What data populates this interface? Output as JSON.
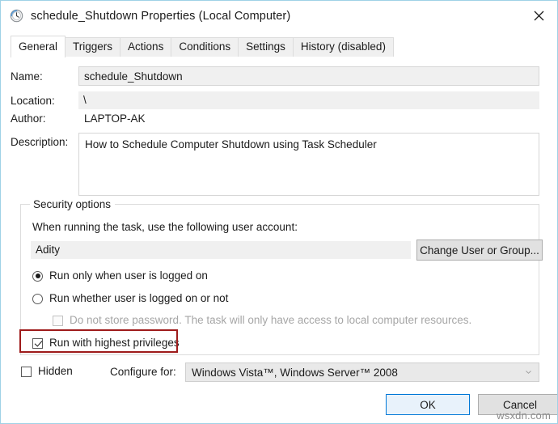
{
  "window": {
    "title": "schedule_Shutdown Properties (Local Computer)",
    "icon": "task-scheduler-clock-icon",
    "close_label": "✕"
  },
  "tabs": [
    {
      "label": "General",
      "active": true
    },
    {
      "label": "Triggers",
      "active": false
    },
    {
      "label": "Actions",
      "active": false
    },
    {
      "label": "Conditions",
      "active": false
    },
    {
      "label": "Settings",
      "active": false
    },
    {
      "label": "History (disabled)",
      "active": false
    }
  ],
  "fields": {
    "name_label": "Name:",
    "name_value": "schedule_Shutdown",
    "location_label": "Location:",
    "location_value": "\\",
    "author_label": "Author:",
    "author_value": "LAPTOP-AK",
    "description_label": "Description:",
    "description_value": "How to Schedule Computer Shutdown using Task Scheduler"
  },
  "security": {
    "legend": "Security options",
    "account_prompt": "When running the task, use the following user account:",
    "account_value": "Adity",
    "change_user_button": "Change User or Group...",
    "radio_logged_on": "Run only when user is logged on",
    "radio_logged_on_selected": true,
    "radio_whether": "Run whether user is logged on or not",
    "radio_whether_selected": false,
    "checkbox_no_password": "Do not store password.  The task will only have access to local computer resources.",
    "checkbox_no_password_checked": false,
    "checkbox_no_password_disabled": true,
    "checkbox_highest_privileges": "Run with highest privileges",
    "checkbox_highest_privileges_checked": true
  },
  "footer": {
    "hidden_label": "Hidden",
    "hidden_checked": false,
    "configure_for_label": "Configure for:",
    "configure_for_value": "Windows Vista™, Windows Server™ 2008",
    "ok_button": "OK",
    "cancel_button": "Cancel"
  },
  "watermark": "wsxdn.com",
  "colors": {
    "window_border": "#9fd2e6",
    "accent_blue": "#0078d7",
    "highlight_red": "#9e1b1b",
    "field_gray": "#f0f0f0"
  }
}
